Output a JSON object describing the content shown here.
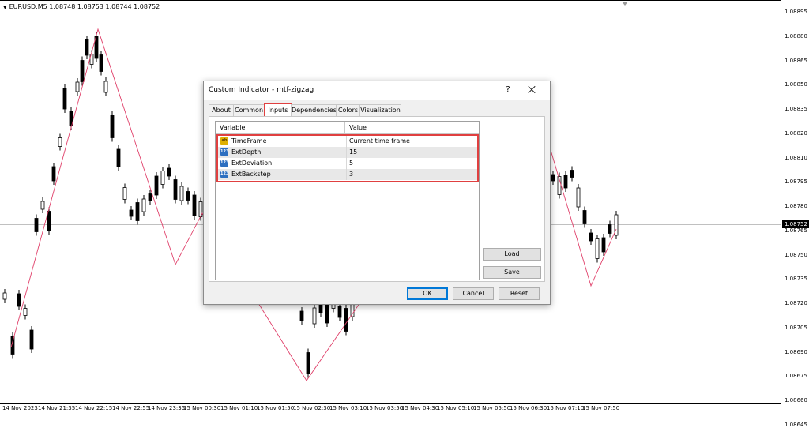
{
  "chart": {
    "title": "EURUSD,M5  1.08748 1.08753 1.08744 1.08752",
    "current_price": "1.08752",
    "price_ticks": [
      "1.08895",
      "1.08880",
      "1.08865",
      "1.08850",
      "1.08835",
      "1.08820",
      "1.08810",
      "1.08795",
      "1.08780",
      "1.08765",
      "1.08750",
      "1.08735",
      "1.08720",
      "1.08705",
      "1.08690",
      "1.08675",
      "1.08660",
      "1.08645"
    ],
    "time_ticks": [
      "14 Nov 2023",
      "14 Nov 21:35",
      "14 Nov 22:15",
      "14 Nov 22:55",
      "14 Nov 23:35",
      "15 Nov 00:30",
      "15 Nov 01:10",
      "15 Nov 01:50",
      "15 Nov 02:30",
      "15 Nov 03:10",
      "15 Nov 03:50",
      "15 Nov 04:30",
      "15 Nov 05:10",
      "15 Nov 05:50",
      "15 Nov 06:30",
      "15 Nov 07:10",
      "15 Nov 07:50"
    ],
    "colors": {
      "candle": "#000000",
      "zigzag": "#e0406a",
      "price_line": "#c0c0c0",
      "background": "#ffffff"
    }
  },
  "dialog": {
    "title": "Custom Indicator - mtf-zigzag",
    "help_label": "?",
    "tabs": [
      {
        "label": "About",
        "active": false
      },
      {
        "label": "Common",
        "active": false
      },
      {
        "label": "Inputs",
        "active": true
      },
      {
        "label": "Dependencies",
        "active": false
      },
      {
        "label": "Colors",
        "active": false
      },
      {
        "label": "Visualization",
        "active": false
      }
    ],
    "grid": {
      "headers": [
        "Variable",
        "Value"
      ],
      "rows": [
        {
          "icon": "ab",
          "icon_name": "string-type-icon",
          "variable": "TimeFrame",
          "value": "Current time frame"
        },
        {
          "icon": "123",
          "icon_name": "integer-type-icon",
          "variable": "ExtDepth",
          "value": "15"
        },
        {
          "icon": "123",
          "icon_name": "integer-type-icon",
          "variable": "ExtDeviation",
          "value": "5"
        },
        {
          "icon": "123",
          "icon_name": "integer-type-icon",
          "variable": "ExtBackstep",
          "value": "3"
        }
      ]
    },
    "buttons": {
      "load": "Load",
      "save": "Save",
      "ok": "OK",
      "cancel": "Cancel",
      "reset": "Reset"
    },
    "accent_color": "#e04040"
  }
}
